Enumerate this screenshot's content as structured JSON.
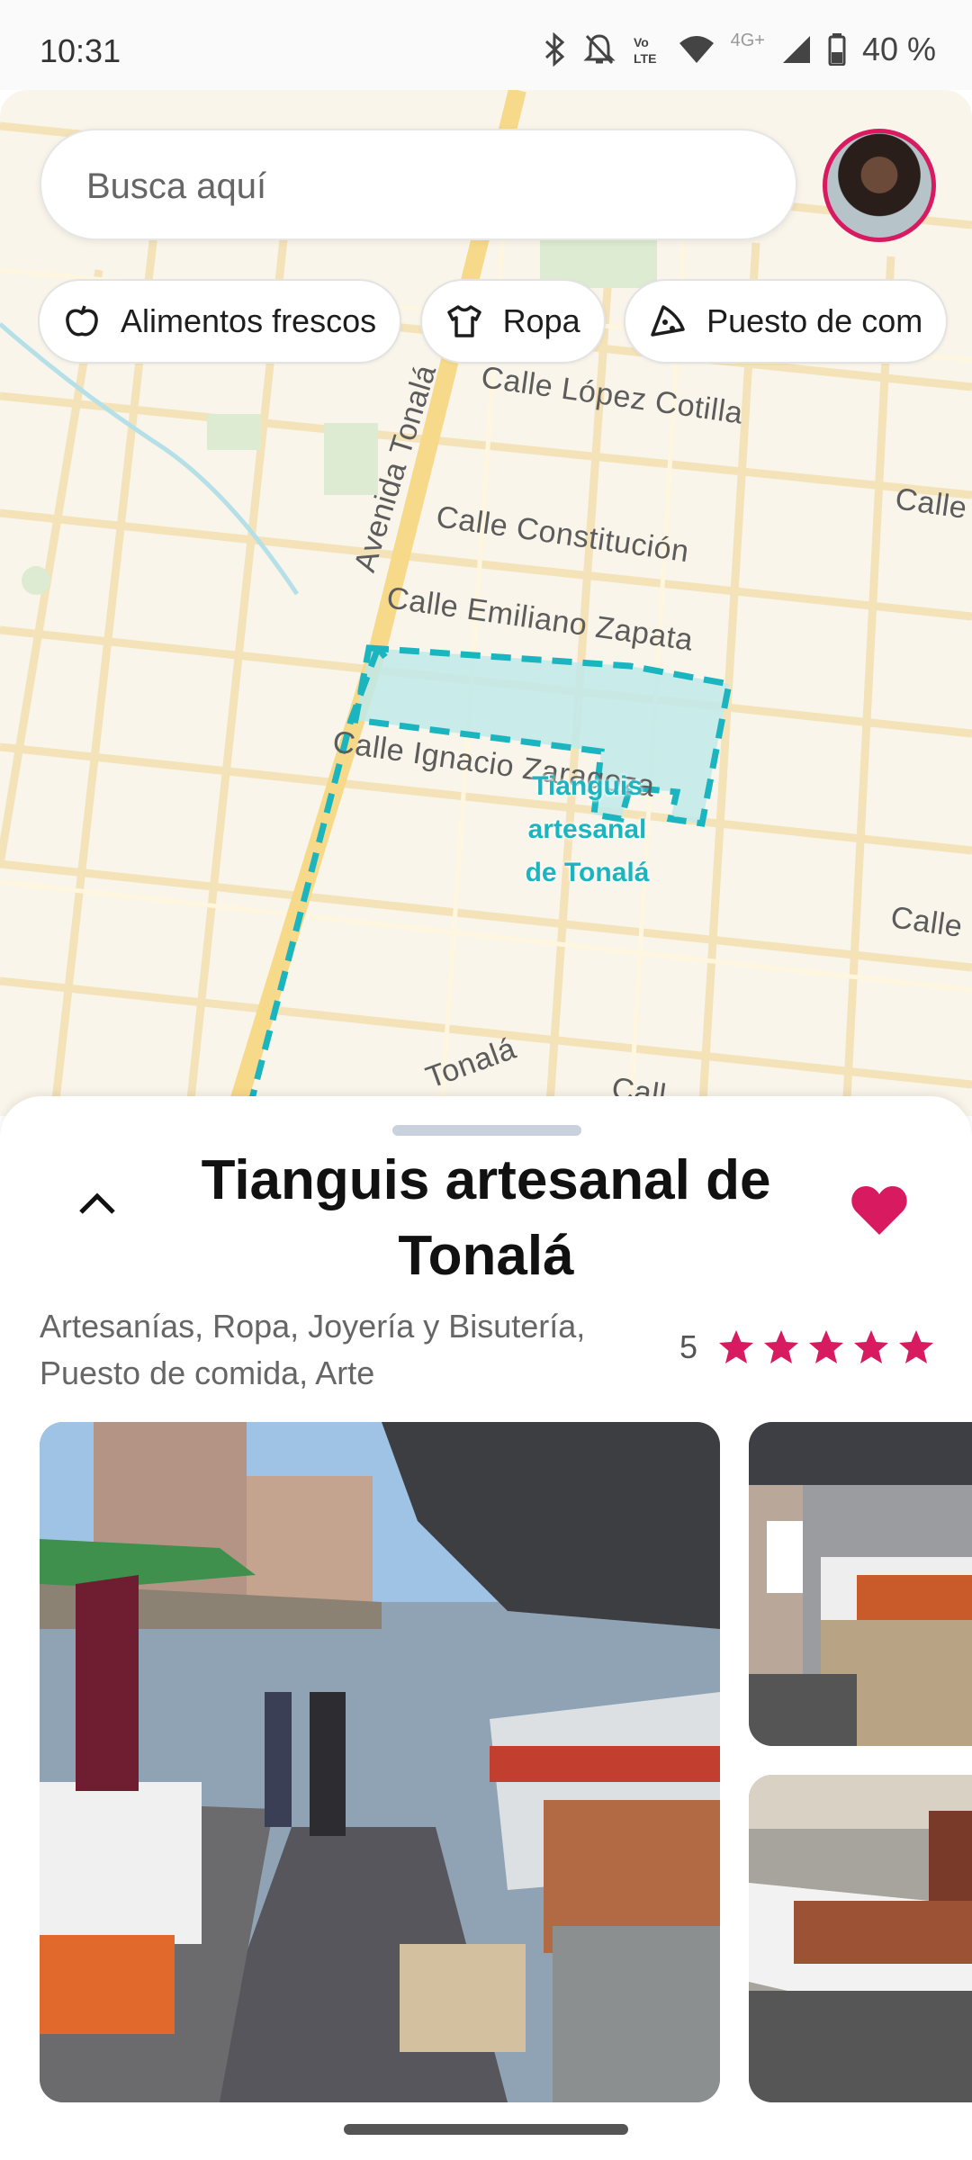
{
  "status_bar": {
    "time": "10:31",
    "network_label": "4G+",
    "battery": "40 %"
  },
  "search": {
    "placeholder": "Busca aquí"
  },
  "chips": [
    {
      "label": "Alimentos frescos",
      "icon": "apple-icon"
    },
    {
      "label": "Ropa",
      "icon": "shirt-icon"
    },
    {
      "label": "Puesto de com",
      "icon": "pizza-icon"
    }
  ],
  "map": {
    "streets": {
      "avenida_tonala": "Avenida Tonalá",
      "lopez_cotilla": "Calle López Cotilla",
      "calle_right_1": "Calle",
      "constitucion": "Calle Constitución",
      "emiliano_zapata": "Calle Emiliano Zapata",
      "ignacio_zaragoza": "Calle Ignacio Zaragoza",
      "calle_right_2": "Calle",
      "tonala_bottom": "Tonalá",
      "calle_bottom": "Call"
    },
    "poi_label": "Tianguis artesanal de Tonalá",
    "poi_color": "#1bb5bf"
  },
  "place": {
    "title": "Tianguis artesanal de Tonalá",
    "categories": "Artesanías, Ropa, Joyería y Bisutería, Puesto de comida, Arte",
    "rating": "5",
    "stars": 5,
    "accent_color": "#d81b60"
  }
}
